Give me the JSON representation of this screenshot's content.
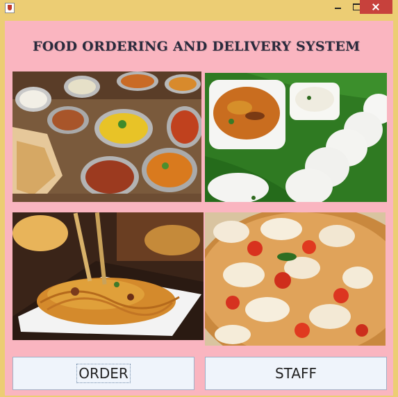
{
  "window": {
    "icon": "java-cup-icon",
    "controls": [
      "minimize-icon",
      "maximize-icon",
      "close-icon"
    ],
    "accent": "#c7413c"
  },
  "app": {
    "title": "FOOD ORDERING AND DELIVERY SYSTEM",
    "background": "#fab5c0"
  },
  "images": [
    {
      "name": "indian-curries-photo"
    },
    {
      "name": "idli-sambar-photo"
    },
    {
      "name": "noodles-photo"
    },
    {
      "name": "pizza-photo"
    }
  ],
  "buttons": {
    "order": "ORDER",
    "staff": "STAFF"
  }
}
